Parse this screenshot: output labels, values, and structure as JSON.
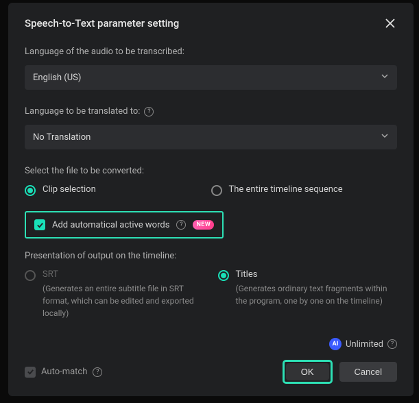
{
  "dialog": {
    "title": "Speech-to-Text parameter setting"
  },
  "language_audio": {
    "label": "Language of the audio to be transcribed:",
    "value": "English (US)"
  },
  "language_translate": {
    "label": "Language to be translated to:",
    "value": "No Translation"
  },
  "file_select": {
    "label": "Select the file to be converted:",
    "option_clip": "Clip selection",
    "option_timeline": "The entire timeline sequence"
  },
  "active_words": {
    "label": "Add automatical active words",
    "badge": "NEW"
  },
  "presentation": {
    "label": "Presentation of output on the timeline:",
    "srt": {
      "title": "SRT",
      "desc": "(Generates an entire subtitle file in SRT format, which can be edited and exported locally)"
    },
    "titles": {
      "title": "Titles",
      "desc": "(Generates ordinary text fragments within the program, one by one on the timeline)"
    }
  },
  "footer": {
    "ai": "AI",
    "unlimited": "Unlimited",
    "auto_match": "Auto-match",
    "ok": "OK",
    "cancel": "Cancel"
  }
}
